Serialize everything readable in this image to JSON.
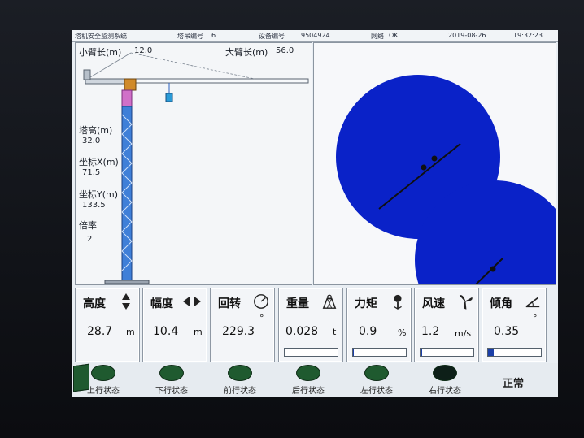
{
  "header": {
    "system_title": "塔机安全监测系统",
    "tower_no_label": "塔吊编号",
    "tower_no": "6",
    "device_no_label": "设备编号",
    "device_no": "9504924",
    "network_label": "网络",
    "network_status": "OK",
    "date": "2019-08-26",
    "time": "19:32:23"
  },
  "crane": {
    "small_arm_label": "小臂长(m)",
    "small_arm_value": "12.0",
    "big_arm_label": "大臂长(m)",
    "big_arm_value": "56.0",
    "tower_height_label": "塔高(m)",
    "tower_height_value": "32.0",
    "coord_x_label": "坐标X(m)",
    "coord_x_value": "71.5",
    "coord_y_label": "坐标Y(m)",
    "coord_y_value": "133.5",
    "ratio_label": "倍率",
    "ratio_value": "2"
  },
  "readouts": [
    {
      "title": "高度",
      "value": "28.7",
      "unit": "m",
      "icon": "up-down-arrows-icon"
    },
    {
      "title": "幅度",
      "value": "10.4",
      "unit": "m",
      "icon": "left-right-arrows-icon"
    },
    {
      "title": "回转",
      "value": "229.3",
      "unit": "°",
      "icon": "rotation-dial-icon"
    },
    {
      "title": "重量",
      "value": "0.028",
      "unit": "t",
      "icon": "weight-icon",
      "bar": 0.0
    },
    {
      "title": "力矩",
      "value": "0.9",
      "unit": "%",
      "icon": "moment-icon",
      "bar": 0.009
    },
    {
      "title": "风速",
      "value": "1.2",
      "unit": "m/s",
      "icon": "fan-icon",
      "bar": 0.03
    },
    {
      "title": "倾角",
      "value": "0.35",
      "unit": "°",
      "icon": "tilt-angle-icon",
      "bar": 0.1
    }
  ],
  "status": [
    {
      "label": "上行状态",
      "state": "on"
    },
    {
      "label": "下行状态",
      "state": "on"
    },
    {
      "label": "前行状态",
      "state": "on"
    },
    {
      "label": "后行状态",
      "state": "on"
    },
    {
      "label": "左行状态",
      "state": "on"
    },
    {
      "label": "右行状态",
      "state": "off"
    },
    {
      "label": "正常",
      "state": "text"
    }
  ],
  "colors": {
    "accent": "#0a22c8",
    "status_on": "#1f5a2f",
    "bar_fill": "#1b3fa8"
  }
}
